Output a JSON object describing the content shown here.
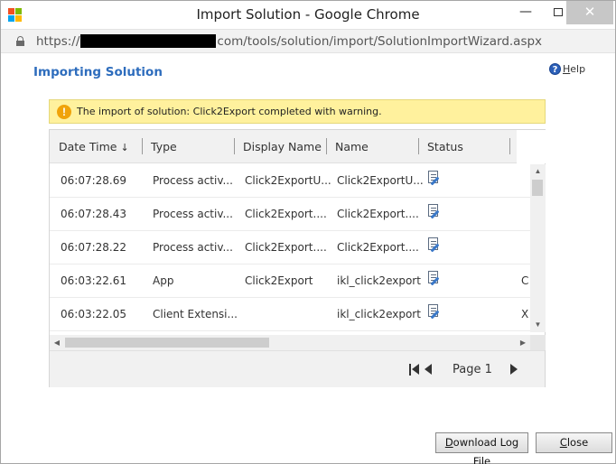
{
  "window": {
    "title": "Import Solution - Google Chrome",
    "minimize_glyph": "—",
    "close_glyph": "✕"
  },
  "address": {
    "scheme": "https://",
    "path": "com/tools/solution/import/SolutionImportWizard.aspx"
  },
  "page": {
    "heading": "Importing Solution",
    "help_first_letter": "H",
    "help_rest": "elp"
  },
  "warning": {
    "text": "The import of solution: Click2Export completed with warning.",
    "icon_glyph": "!"
  },
  "grid": {
    "columns": {
      "date_time": "Date Time",
      "sort_glyph": "↓",
      "type": "Type",
      "display_name": "Display Name",
      "name": "Name",
      "status": "Status"
    },
    "rows": [
      {
        "date_time": "06:07:28.69",
        "type": "Process activ...",
        "display_name": "Click2ExportU...",
        "name": "Click2ExportU...",
        "extra": ""
      },
      {
        "date_time": "06:07:28.43",
        "type": "Process activ...",
        "display_name": "Click2Export....",
        "name": "Click2Export....",
        "extra": ""
      },
      {
        "date_time": "06:07:28.22",
        "type": "Process activ...",
        "display_name": "Click2Export....",
        "name": "Click2Export....",
        "extra": ""
      },
      {
        "date_time": "06:03:22.61",
        "type": "App",
        "display_name": "Click2Export",
        "name": "ikl_click2export",
        "extra": "C"
      },
      {
        "date_time": "06:03:22.05",
        "type": "Client Extensi...",
        "display_name": "",
        "name": "ikl_click2export",
        "extra": "X"
      }
    ],
    "pager": {
      "page_label": "Page 1"
    }
  },
  "buttons": {
    "download_first": "D",
    "download_rest": "ownload Log File",
    "close_first": "C",
    "close_rest": "lose"
  },
  "icons": {
    "app": "windows-logo-icon",
    "lock": "lock-icon",
    "help": "help-icon",
    "warning": "warning-icon",
    "status": "document-edit-icon"
  },
  "colors": {
    "heading": "#2e6dbd",
    "warning_bg": "#fff19d",
    "warning_icon": "#f0a30a"
  }
}
